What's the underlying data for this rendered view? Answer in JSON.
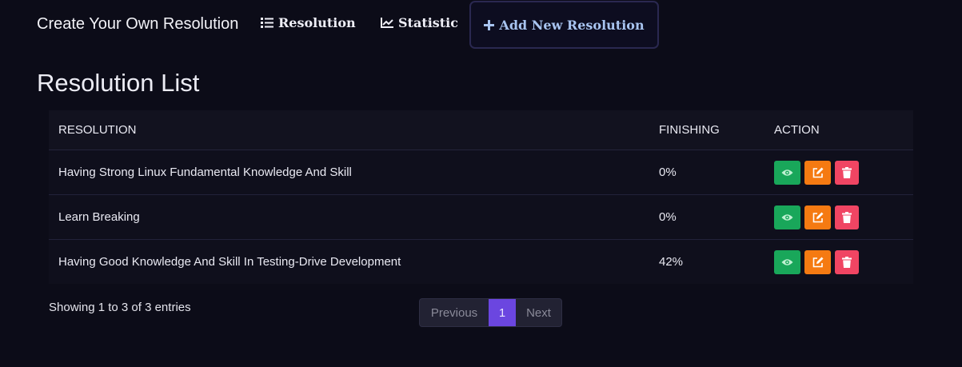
{
  "navbar": {
    "brand": "Create Your Own Resolution",
    "links": [
      {
        "label": "Resolution",
        "icon": "list-icon"
      },
      {
        "label": "Statistic",
        "icon": "chart-line-icon"
      }
    ],
    "add_button": {
      "label": "Add New Resolution",
      "icon": "plus-icon"
    }
  },
  "page": {
    "title": "Resolution List"
  },
  "table": {
    "headers": [
      "RESOLUTION",
      "FINISHING",
      "ACTION"
    ],
    "rows": [
      {
        "resolution": "Having Strong Linux Fundamental Knowledge And Skill",
        "finishing": "0%"
      },
      {
        "resolution": "Learn Breaking",
        "finishing": "0%"
      },
      {
        "resolution": "Having Good Knowledge And Skill In Testing-Drive Development",
        "finishing": "42%"
      }
    ]
  },
  "footer": {
    "entries_text": "Showing 1 to 3 of 3 entries",
    "pagination": {
      "previous": "Previous",
      "current": "1",
      "next": "Next"
    }
  },
  "colors": {
    "background": "#0c0c18",
    "view": "#19a75a",
    "edit": "#f57a12",
    "delete": "#f04563",
    "active_page": "#6b46e0",
    "add_link": "#a8c4f0"
  }
}
